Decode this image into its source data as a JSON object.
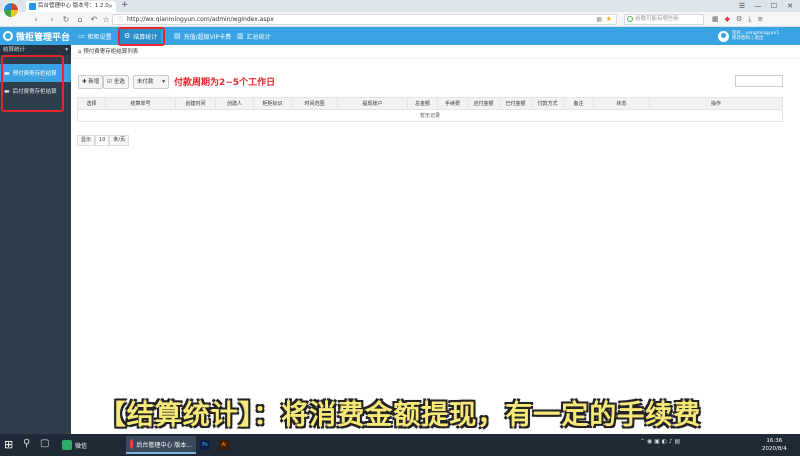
{
  "browser": {
    "tab_title": "后台管理中心 版本号：1.2.0",
    "tab_close": "×",
    "new_tab": "+",
    "address": "http://wx.qianmingyun.com/admin/wgIndex.aspx",
    "search_placeholder": "谷歌可能有哪些新",
    "window_buttons": [
      "☰",
      "—",
      "☐",
      "✕"
    ]
  },
  "app": {
    "brand": "微柜管理平台",
    "menu": [
      {
        "label": "柜柜设置",
        "icon": "monitor-icon"
      },
      {
        "label": "结算统计",
        "icon": "gear-icon"
      },
      {
        "label": "充值/超级VIP卡费",
        "icon": "card-icon"
      },
      {
        "label": "汇总统计",
        "icon": "chart-icon"
      }
    ],
    "user": {
      "line1": "您好，yangmingyun1",
      "line2": "修改密码 | 退出"
    }
  },
  "sidebar": {
    "header": "结算统计",
    "items": [
      {
        "label": "预付费寄存柜结算"
      },
      {
        "label": "后付费寄存柜结算"
      }
    ]
  },
  "main": {
    "breadcrumb": "预付费寄存柜结算列表",
    "buttons": {
      "add": "新增",
      "select_all": "全选",
      "status": "未付款"
    },
    "note": "付款周期为2~5个工作日",
    "columns": [
      "选择",
      "结算单号",
      "创建时间",
      "创建人",
      "柜柜标识",
      "时间范围",
      "提现账户",
      "总金额",
      "手续费",
      "应付金额",
      "已付金额",
      "付款方式",
      "备注",
      "状态",
      "操作"
    ],
    "empty_text": "暂无记录",
    "pager": {
      "prefix": "显示",
      "size": "10",
      "suffix": "条/页"
    }
  },
  "subtitle": "【结算统计】：将消费金额提现，有一定的手续费",
  "taskbar": {
    "apps": [
      {
        "label": "微信",
        "color": "#2aae67"
      },
      {
        "label": "后台管理中心 版本...",
        "color": "#e8453c"
      },
      {
        "label": "Ps",
        "color": "#0b1f4a"
      },
      {
        "label": "Ai",
        "color": "#3d1d00"
      }
    ],
    "time": "16:36",
    "date": "2020/8/4"
  },
  "colors": {
    "accent": "#3aa3e3",
    "highlight_box": "#e8262a",
    "subtitle": "#f7e87a"
  }
}
